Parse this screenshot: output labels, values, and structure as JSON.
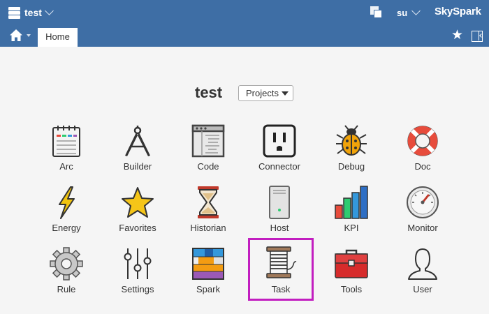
{
  "header": {
    "project": "test",
    "user": "su",
    "brand": "SkySpark"
  },
  "tabs": [
    {
      "label": "Home"
    }
  ],
  "page": {
    "title": "test",
    "selector": {
      "selected": "Projects"
    }
  },
  "apps": [
    {
      "label": "Arc",
      "icon": "notebook-icon"
    },
    {
      "label": "Builder",
      "icon": "compass-icon"
    },
    {
      "label": "Code",
      "icon": "code-window-icon"
    },
    {
      "label": "Connector",
      "icon": "outlet-icon"
    },
    {
      "label": "Debug",
      "icon": "bug-icon"
    },
    {
      "label": "Doc",
      "icon": "lifebuoy-icon"
    },
    {
      "label": "Energy",
      "icon": "lightning-icon"
    },
    {
      "label": "Favorites",
      "icon": "star-icon"
    },
    {
      "label": "Historian",
      "icon": "hourglass-icon"
    },
    {
      "label": "Host",
      "icon": "server-icon"
    },
    {
      "label": "KPI",
      "icon": "bar-chart-icon"
    },
    {
      "label": "Monitor",
      "icon": "gauge-icon"
    },
    {
      "label": "Rule",
      "icon": "gear-icon"
    },
    {
      "label": "Settings",
      "icon": "sliders-icon"
    },
    {
      "label": "Spark",
      "icon": "spark-blocks-icon"
    },
    {
      "label": "Task",
      "icon": "spool-icon"
    },
    {
      "label": "Tools",
      "icon": "toolbox-icon"
    },
    {
      "label": "User",
      "icon": "user-silhouette-icon"
    }
  ],
  "highlighted_app": "Task",
  "colors": {
    "header": "#3e6ea5",
    "highlight": "#c21ec0",
    "background": "#f5f5f5"
  }
}
